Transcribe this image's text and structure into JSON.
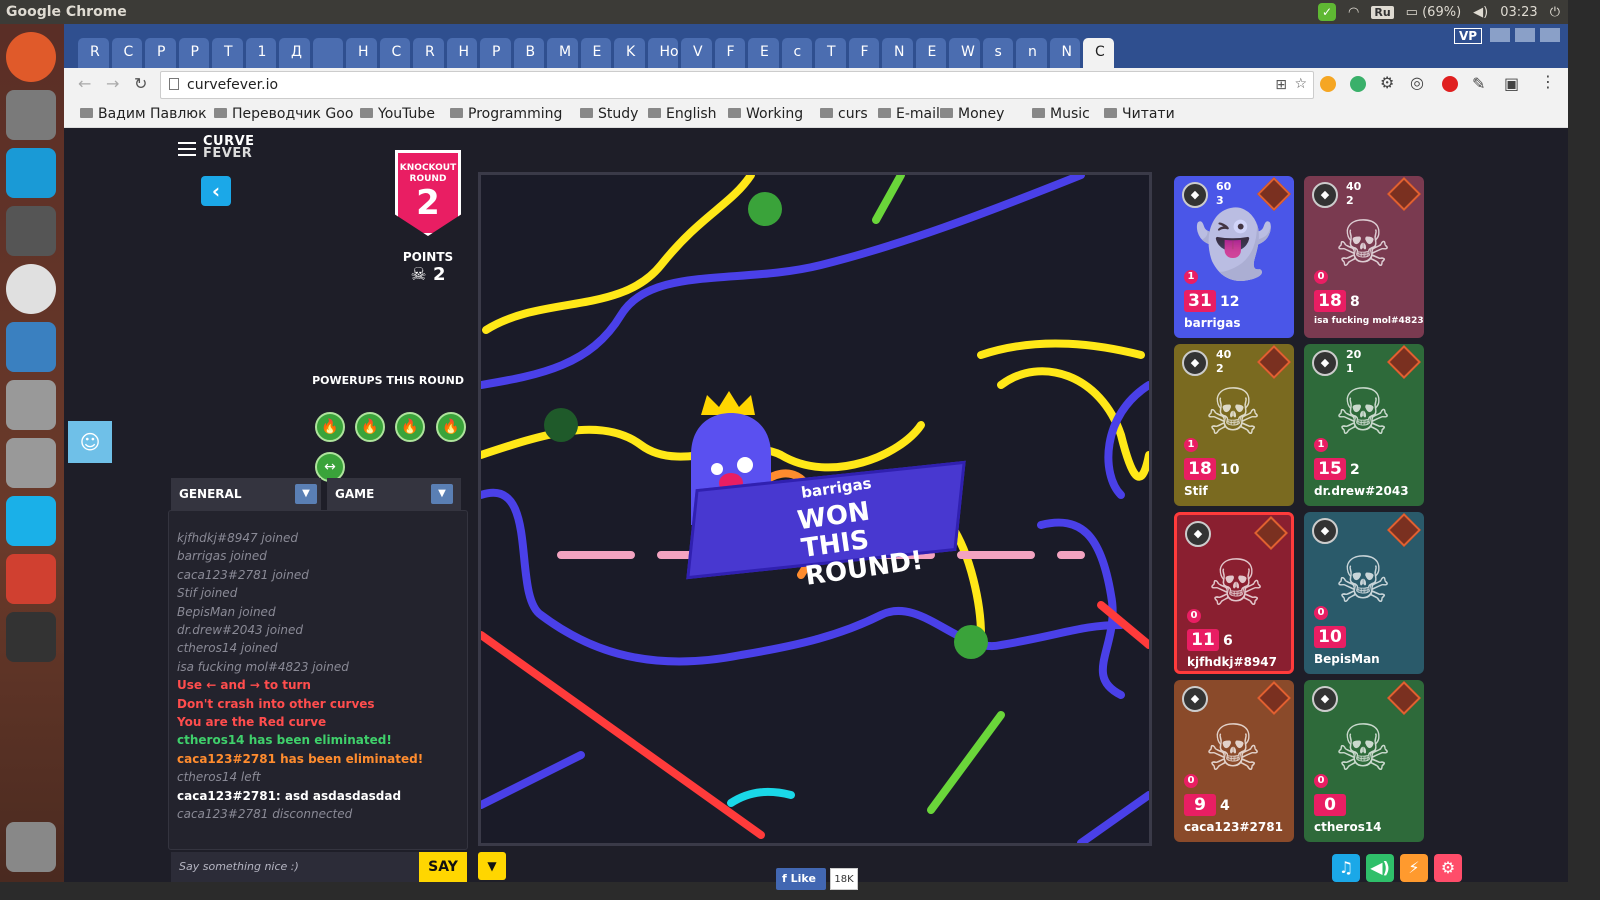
{
  "os": {
    "app_title": "Google Chrome",
    "battery": "(69%)",
    "time": "03:23",
    "lang": "Ru"
  },
  "browser": {
    "url": "curvefever.io",
    "profile": "VP",
    "tabs": [
      "R",
      "C",
      "P",
      "P",
      "T",
      "1",
      "Д",
      "",
      "H",
      "C",
      "R",
      "H",
      "P",
      "B",
      "M",
      "E",
      "K",
      "Нов",
      "V",
      "F",
      "E",
      "c",
      "T",
      "F",
      "N",
      "E",
      "W",
      "s",
      "n",
      "N",
      "C"
    ],
    "bookmarks": [
      "Вадим Павлюк",
      "Переводчик Goo",
      "YouTube",
      "Programming",
      "Study",
      "English",
      "Working",
      "curs",
      "E-mail",
      "Money",
      "Music",
      "Читати"
    ]
  },
  "game": {
    "logo_line1": "CURVE",
    "logo_line2": "FEVER",
    "knockout_label": "KNOCKOUT ROUND",
    "round_number": "2",
    "points_label": "POINTS",
    "points_value": "2",
    "powerups_title": "POWERUPS THIS ROUND",
    "winner_name": "barrigas",
    "won_text_line1": "WON THIS",
    "won_text_line2": "ROUND!"
  },
  "chat": {
    "tab_general": "GENERAL",
    "tab_game": "GAME",
    "messages": [
      {
        "text": "kjfhdkj#8947 joined",
        "style": "join"
      },
      {
        "text": "barrigas joined",
        "style": "join"
      },
      {
        "text": "caca123#2781 joined",
        "style": "join"
      },
      {
        "text": "Stif joined",
        "style": "join"
      },
      {
        "text": "BepisMan joined",
        "style": "join"
      },
      {
        "text": "dr.drew#2043 joined",
        "style": "join"
      },
      {
        "text": "ctheros14 joined",
        "style": "join"
      },
      {
        "text": "isa fucking mol#4823 joined",
        "style": "join"
      },
      {
        "text": "Use ← and → to turn",
        "style": "red"
      },
      {
        "text": "Don't crash into other curves",
        "style": "red"
      },
      {
        "text": "You are the Red curve",
        "style": "red"
      },
      {
        "text": "ctheros14 has been eliminated!",
        "style": "green"
      },
      {
        "text": "caca123#2781 has been eliminated!",
        "style": "orange"
      },
      {
        "text": "ctheros14 left",
        "style": "join"
      },
      {
        "text": "caca123#2781: asd asdasdasdad",
        "style": "white"
      },
      {
        "text": "caca123#2781 disconnected",
        "style": "join"
      }
    ],
    "input_placeholder": "Say something nice :)",
    "say_label": "SAY"
  },
  "players": [
    {
      "name": "barrigas",
      "score": "31",
      "kills": "12",
      "coins": "60",
      "gems": "3",
      "candy": "1",
      "color": "#4a56e8"
    },
    {
      "name": "isa fucking mol#4823",
      "score": "18",
      "kills": "8",
      "coins": "40",
      "gems": "2",
      "candy": "0",
      "color": "#7a3a50"
    },
    {
      "name": "Stif",
      "score": "18",
      "kills": "10",
      "coins": "40",
      "gems": "2",
      "candy": "1",
      "color": "#7a6a20"
    },
    {
      "name": "dr.drew#2043",
      "score": "15",
      "kills": "2",
      "coins": "20",
      "gems": "1",
      "candy": "1",
      "color": "#2e6a3a"
    },
    {
      "name": "kjfhdkj#8947",
      "score": "11",
      "kills": "6",
      "coins": "",
      "gems": "",
      "candy": "0",
      "color": "#8a1f30"
    },
    {
      "name": "BepisMan",
      "score": "10",
      "kills": "",
      "coins": "",
      "gems": "",
      "candy": "0",
      "color": "#2a5a6a"
    },
    {
      "name": "caca123#2781",
      "score": "9",
      "kills": "4",
      "coins": "",
      "gems": "",
      "candy": "0",
      "color": "#8a4a2a"
    },
    {
      "name": "ctheros14",
      "score": "0",
      "kills": "",
      "coins": "",
      "gems": "",
      "candy": "0",
      "color": "#2e6a3a"
    }
  ],
  "facebook": {
    "like_label": "Like",
    "like_count": "18K"
  },
  "icons": {
    "music": "music-note-icon",
    "sound": "speaker-icon",
    "graphics": "graphics-icon",
    "settings": "gear-icon"
  }
}
